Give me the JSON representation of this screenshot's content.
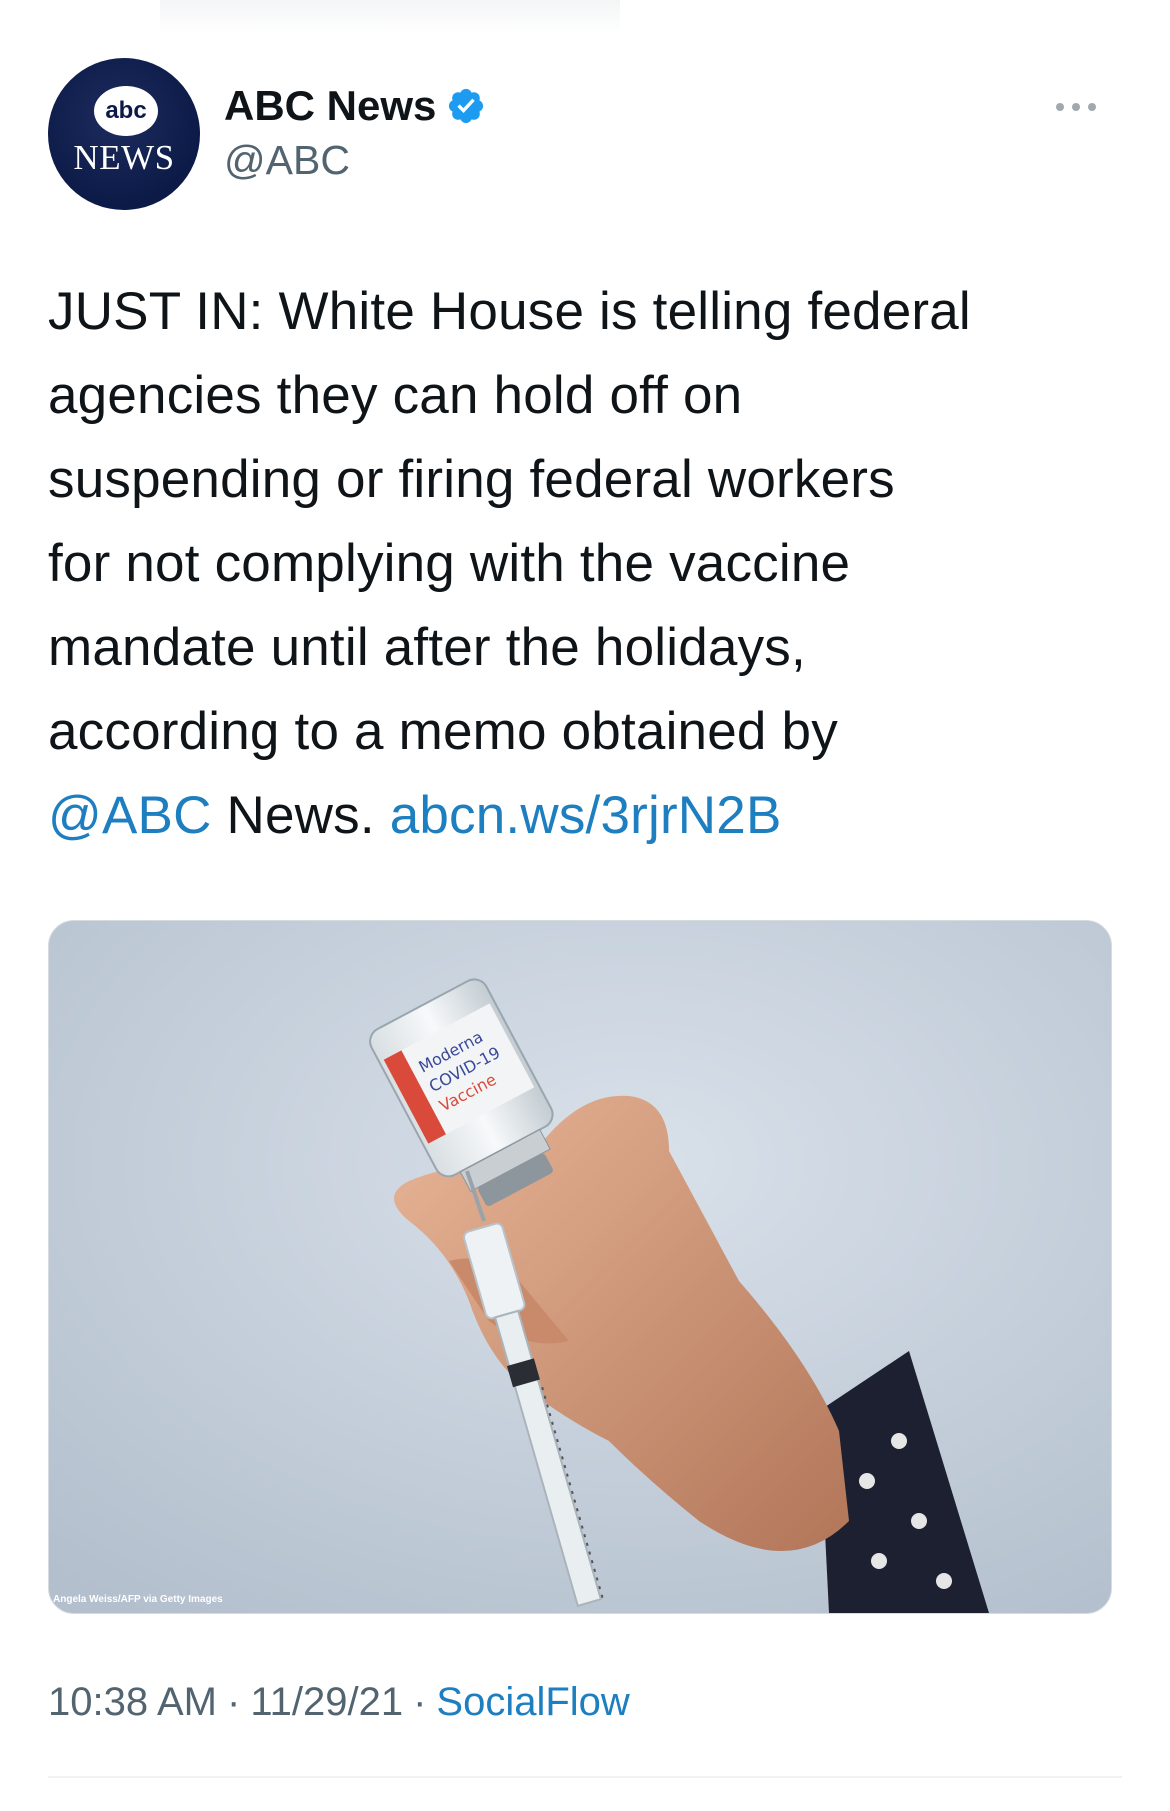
{
  "account": {
    "avatar_text_top": "abc",
    "avatar_text_bottom": "NEWS",
    "display_name": "ABC News",
    "handle": "@ABC",
    "verified": true
  },
  "tweet": {
    "text_lines": [
      "JUST IN: White House is telling federal",
      "agencies they can hold off on",
      "suspending or firing federal workers",
      "for not complying with the vaccine",
      "mandate until after the holidays,",
      "according to a memo obtained by"
    ],
    "mention": "@ABC",
    "after_mention": " News. ",
    "link": "abcn.ws/3rjrN2B"
  },
  "media": {
    "alt_description_icon": "photo-vaccine-vial-syringe",
    "credit": "Angela Weiss/AFP via Getty Images",
    "vial_label_line1": "Moderna",
    "vial_label_line2": "COVID-19",
    "vial_label_line3": "Vaccine"
  },
  "meta": {
    "time": "10:38 AM",
    "date": "11/29/21",
    "source": "SocialFlow",
    "separator": "·"
  },
  "colors": {
    "link": "#1d7ec0",
    "secondary": "#536471",
    "verified": "#1d9bf0",
    "abc_navy": "#0c1a47"
  }
}
